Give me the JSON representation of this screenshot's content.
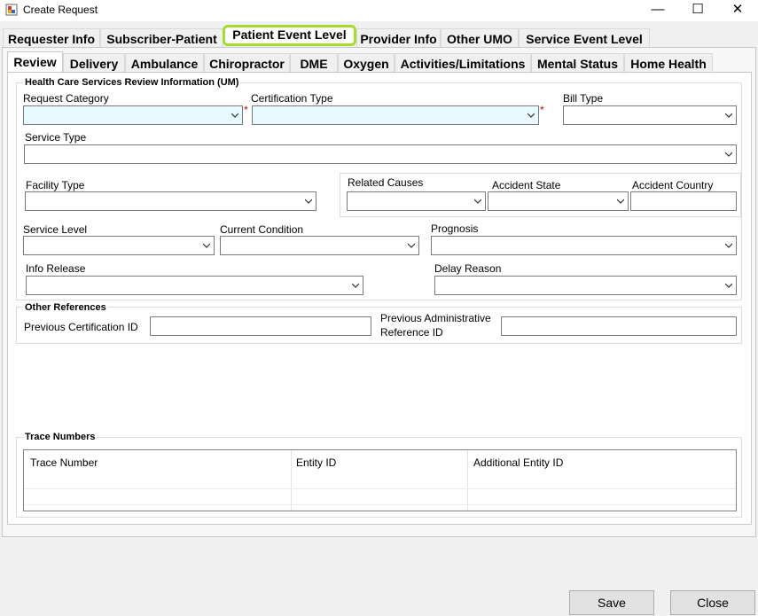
{
  "window": {
    "title": "Create Request",
    "minimize_glyph": "—",
    "maximize_glyph": "☐",
    "close_glyph": "✕"
  },
  "top_tabs": [
    {
      "label": "Requester Info"
    },
    {
      "label": "Subscriber-Patient"
    },
    {
      "label": "Patient Event Level",
      "selected": true
    },
    {
      "label": "Provider Info"
    },
    {
      "label": "Other UMO"
    },
    {
      "label": "Service Event Level"
    }
  ],
  "sub_tabs": [
    {
      "label": "Review",
      "selected": true
    },
    {
      "label": "Delivery"
    },
    {
      "label": "Ambulance"
    },
    {
      "label": "Chiropractor"
    },
    {
      "label": "DME"
    },
    {
      "label": "Oxygen"
    },
    {
      "label": "Activities/Limitations"
    },
    {
      "label": "Mental Status"
    },
    {
      "label": "Home Health"
    }
  ],
  "review": {
    "group_title": "Health Care Services Review Information (UM)",
    "request_category": {
      "label": "Request Category",
      "value": ""
    },
    "certification_type": {
      "label": "Certification Type",
      "value": ""
    },
    "bill_type": {
      "label": "Bill Type",
      "value": ""
    },
    "service_type": {
      "label": "Service Type",
      "value": ""
    },
    "facility_type": {
      "label": "Facility Type",
      "value": ""
    },
    "related_causes": {
      "label": "Related Causes",
      "value": ""
    },
    "accident_state": {
      "label": "Accident State",
      "value": ""
    },
    "accident_country": {
      "label": "Accident Country",
      "value": ""
    },
    "service_level": {
      "label": "Service Level",
      "value": ""
    },
    "current_condition": {
      "label": "Current Condition",
      "value": ""
    },
    "prognosis": {
      "label": "Prognosis",
      "value": ""
    },
    "info_release": {
      "label": "Info Release",
      "value": ""
    },
    "delay_reason": {
      "label": "Delay Reason",
      "value": ""
    },
    "required_marker": "*"
  },
  "other_references": {
    "group_title": "Other References",
    "previous_certification_id": {
      "label": "Previous Certification ID",
      "value": ""
    },
    "previous_admin_ref_line1": "Previous Administrative",
    "previous_admin_ref_line2": "Reference ID",
    "previous_admin_ref_value": ""
  },
  "trace_numbers": {
    "group_title": "Trace Numbers",
    "columns": [
      "Trace Number",
      "Entity ID",
      "Additional Entity ID"
    ]
  },
  "buttons": {
    "save": "Save",
    "close": "Close"
  },
  "colors": {
    "highlight": "#a3dc2a",
    "required_field": "#e8f9ff",
    "required_star": "#c00000"
  }
}
